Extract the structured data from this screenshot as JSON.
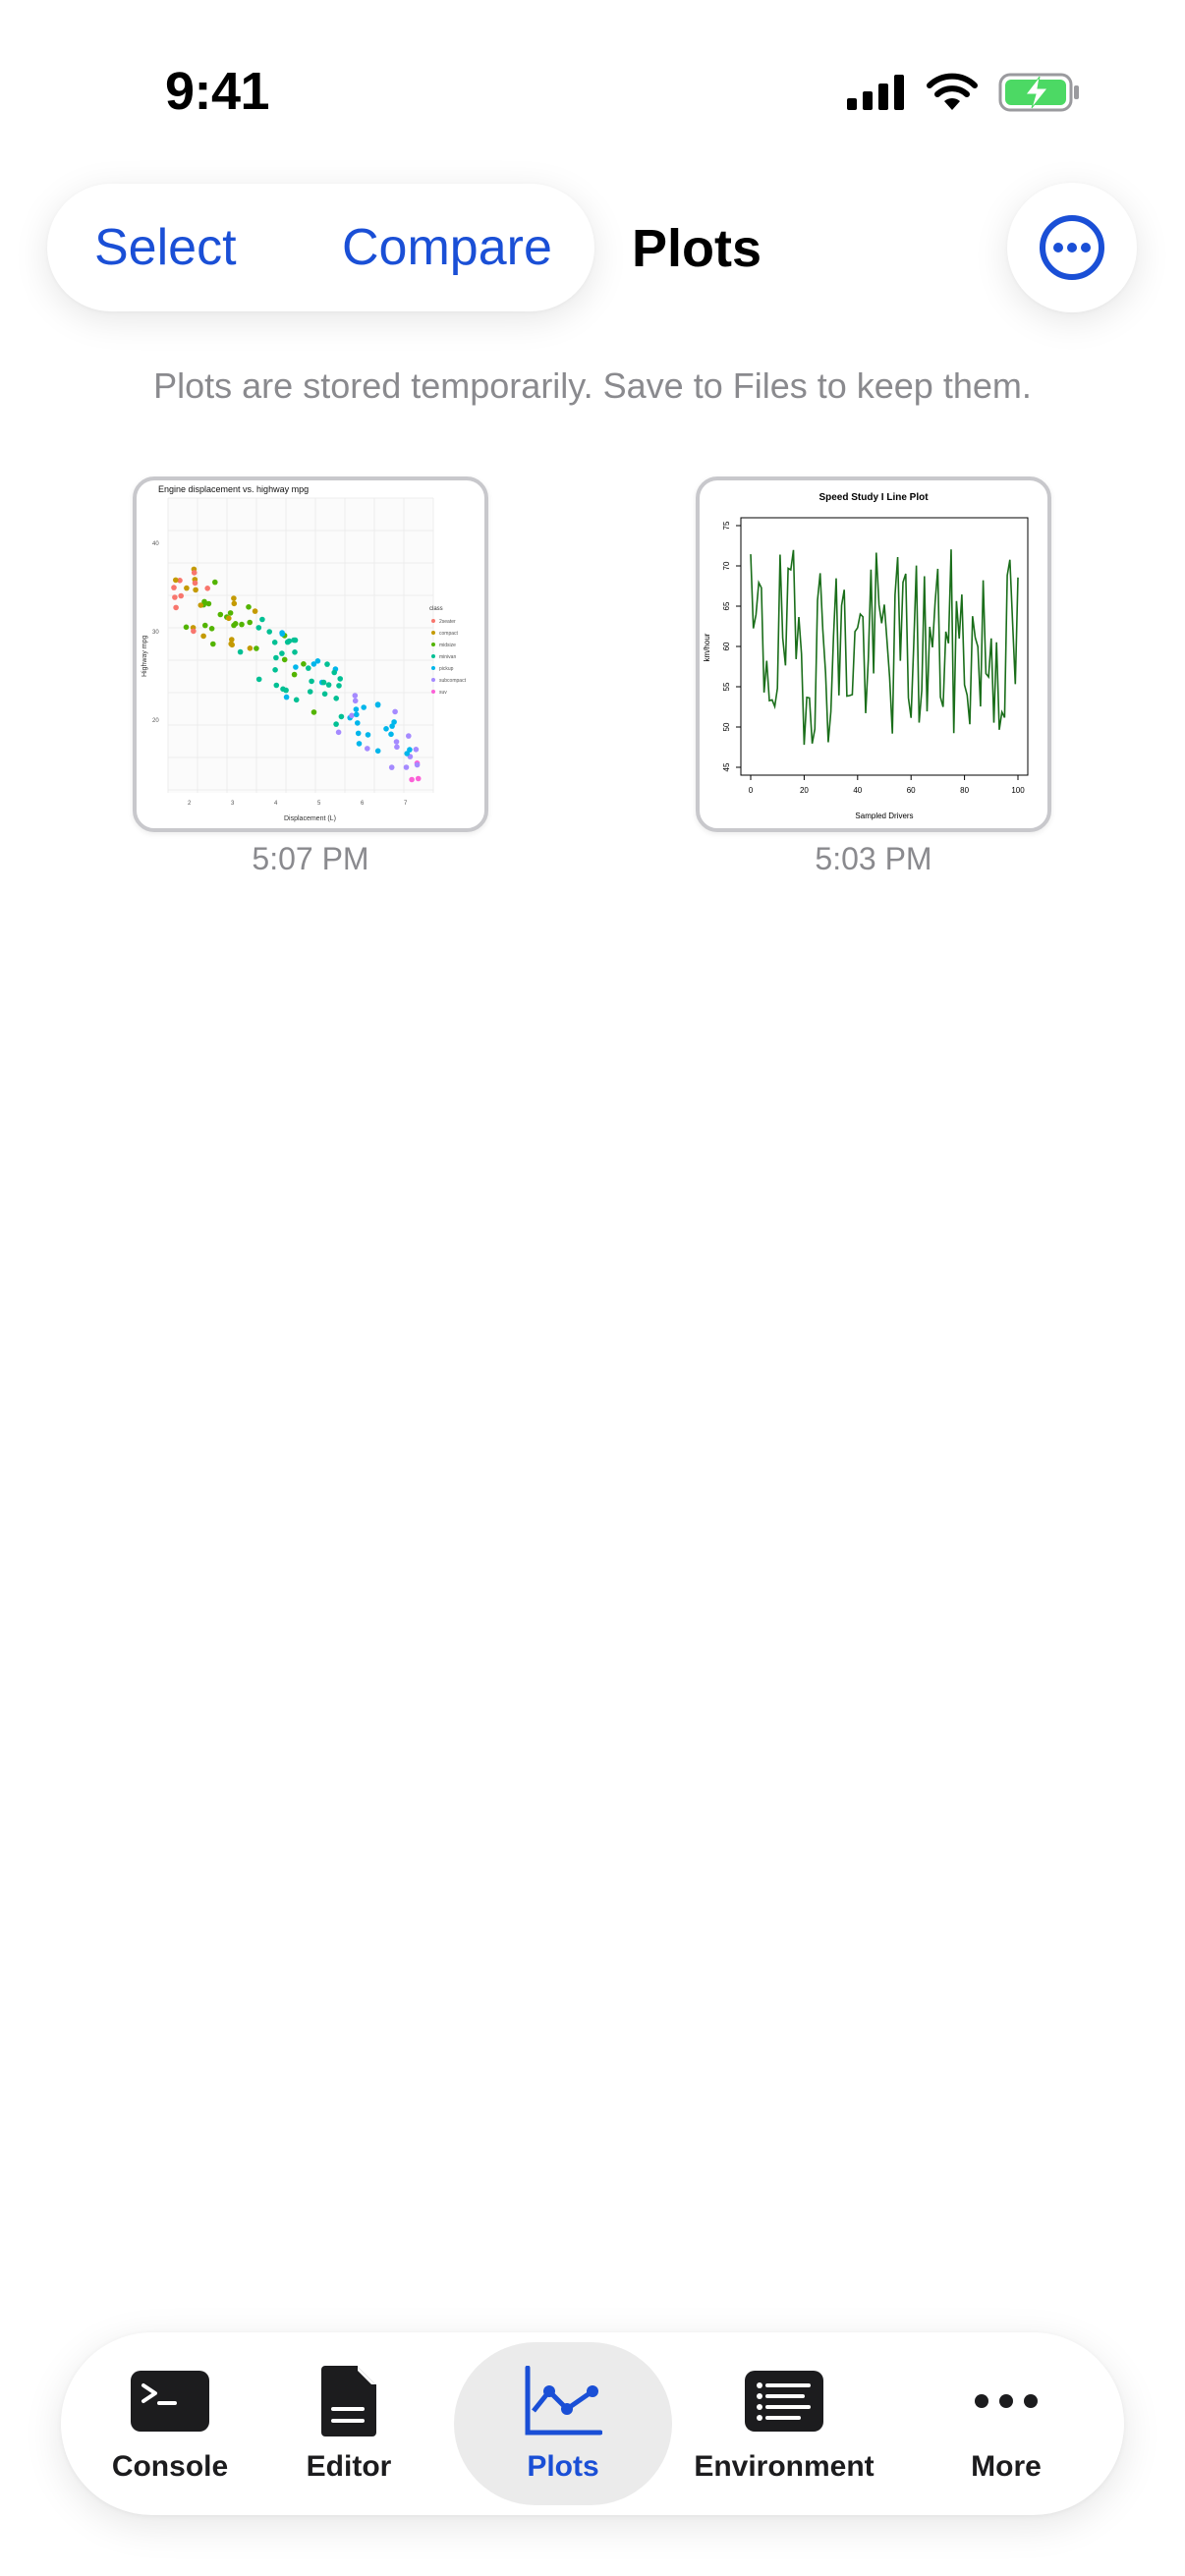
{
  "status_bar": {
    "time": "9:41",
    "icons": [
      "signal-icon",
      "wifi-icon",
      "battery-charging-icon"
    ]
  },
  "header": {
    "select_label": "Select",
    "compare_label": "Compare",
    "title": "Plots",
    "more_icon": "ellipsis-circle-icon"
  },
  "hint": "Plots are stored temporarily. Save to Files to keep them.",
  "plots": [
    {
      "time": "5:07 PM",
      "thumbnail": {
        "title": "Engine displacement vs. highway mpg",
        "xlabel": "Displacement (L)",
        "ylabel": "Highway mpg",
        "x_ticks": [
          "2",
          "3",
          "4",
          "5",
          "6",
          "7"
        ],
        "y_ticks": [
          "40",
          "30",
          "20"
        ],
        "legend_title": "class",
        "legend": [
          "2seater",
          "compact",
          "midsize",
          "minivan",
          "pickup",
          "subcompact",
          "suv"
        ]
      }
    },
    {
      "time": "5:03 PM",
      "thumbnail": {
        "title": "Speed Study I Line Plot",
        "xlabel": "Sampled Drivers",
        "ylabel": "km/hour",
        "x_ticks": [
          "0",
          "20",
          "40",
          "60",
          "80",
          "100"
        ],
        "y_ticks": [
          "75",
          "70",
          "65",
          "60",
          "55",
          "50",
          "45"
        ]
      }
    }
  ],
  "tabs": [
    {
      "label": "Console",
      "icon": "terminal-icon",
      "active": false
    },
    {
      "label": "Editor",
      "icon": "document-icon",
      "active": false
    },
    {
      "label": "Plots",
      "icon": "line-chart-icon",
      "active": true
    },
    {
      "label": "Environment",
      "icon": "list-icon",
      "active": false
    },
    {
      "label": "More",
      "icon": "ellipsis-icon",
      "active": false
    }
  ],
  "colors": {
    "accent": "#1a4fd6",
    "secondary_text": "#8a8a8e",
    "active_tab_bg": "#ebebeb",
    "battery_green": "#4cd964",
    "line_plot": "#1a6e1a",
    "scatter_palette": [
      "#f8766d",
      "#c49a00",
      "#53b400",
      "#00c094",
      "#00b6eb",
      "#a58aff",
      "#fb61d7"
    ]
  }
}
